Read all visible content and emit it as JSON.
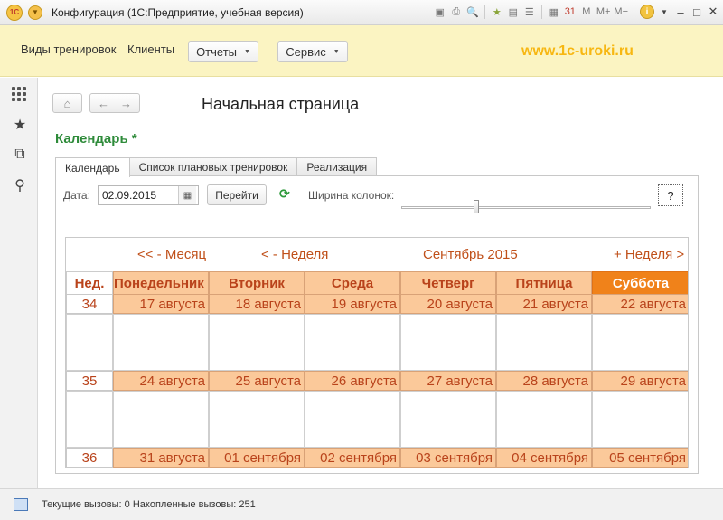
{
  "window": {
    "title": "Конфигурация  (1С:Предприятие, учебная версия)",
    "logo": "1С",
    "toolbar_icons": [
      "save-icon",
      "print-icon",
      "preview-icon",
      "favorites-add-icon",
      "history-icon",
      "calculator-icon",
      "calendar-icon",
      "memory-icon",
      "info-icon",
      "minimize-icon",
      "maximize-icon",
      "close-icon"
    ],
    "memory": {
      "m": "M",
      "mplus": "M+",
      "mminus": "M−"
    }
  },
  "mainbar": {
    "items": [
      "Виды тренировок",
      "Клиенты"
    ],
    "reports": "Отчеты",
    "service": "Сервис",
    "site": "www.1c-uroki.ru"
  },
  "sidebar": {
    "icons": [
      "sections-icon",
      "favorites-icon",
      "history-icon",
      "search-icon"
    ]
  },
  "page": {
    "title": "Начальная страница",
    "form_title": "Календарь *"
  },
  "tabs": [
    "Календарь",
    "Список плановых тренировок",
    "Реализация"
  ],
  "toolbar": {
    "date_label": "Дата:",
    "date_value": "02.09.2015",
    "go_label": "Перейти",
    "width_label": "Ширина колонок:",
    "help_label": "?",
    "slider_fraction": 0.3
  },
  "calendar": {
    "nav": {
      "prev_month": "<< - Месяц",
      "prev_week": "< - Неделя",
      "current": "Сентябрь 2015",
      "next_week": "+ Неделя >"
    },
    "headers": [
      "Нед.",
      "Понедельник",
      "Вторник",
      "Среда",
      "Четверг",
      "Пятница",
      "Суббота"
    ],
    "weeks": [
      {
        "num": "34",
        "days": [
          "17 августа",
          "18 августа",
          "19 августа",
          "20 августа",
          "21 августа",
          "22 августа"
        ]
      },
      {
        "num": "35",
        "days": [
          "24 августа",
          "25 августа",
          "26 августа",
          "27 августа",
          "28 августа",
          "29 августа"
        ]
      },
      {
        "num": "36",
        "days": [
          "31 августа",
          "01 сентября",
          "02 сентября",
          "03 сентября",
          "04 сентября",
          "05 сентября"
        ]
      }
    ]
  },
  "status": {
    "text": "Текущие вызовы: 0   Накопленные вызовы: 251"
  },
  "colors": {
    "accent_orange": "#f0821a",
    "day_bg": "#fbc99a",
    "day_text": "#b9431b",
    "form_title": "#2e8b3a",
    "site": "#f7b712",
    "mainbar_bg": "#fbf4c2"
  }
}
